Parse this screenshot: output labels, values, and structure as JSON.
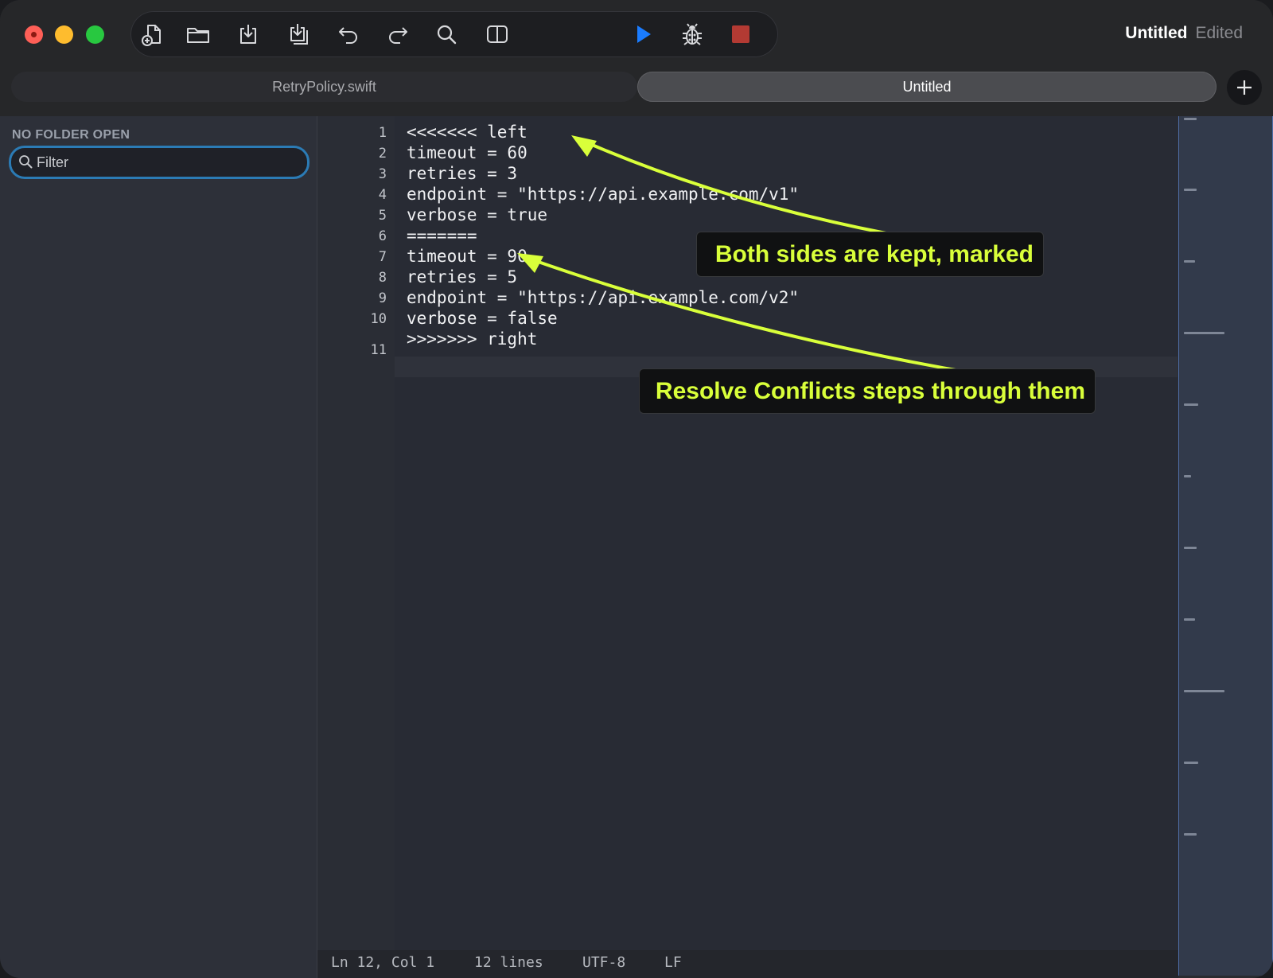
{
  "window": {
    "title": "Untitled",
    "title_status": "Edited"
  },
  "toolbar": {
    "buttons": [
      {
        "name": "new-file",
        "icon": "new-file-icon"
      },
      {
        "name": "open-folder",
        "icon": "folder-icon"
      },
      {
        "name": "save",
        "icon": "download-icon"
      },
      {
        "name": "save-all",
        "icon": "save-all-icon"
      },
      {
        "name": "undo",
        "icon": "undo-icon"
      },
      {
        "name": "redo",
        "icon": "redo-icon"
      },
      {
        "name": "search",
        "icon": "search-icon"
      },
      {
        "name": "split-view",
        "icon": "split-view-icon"
      },
      {
        "name": "run",
        "icon": "play-icon"
      },
      {
        "name": "debug",
        "icon": "bug-icon"
      },
      {
        "name": "stop",
        "icon": "stop-icon"
      }
    ],
    "colors": {
      "run": "#1a7cff",
      "stop": "#b33a33"
    }
  },
  "tabs": [
    {
      "label": "RetryPolicy.swift",
      "active": false
    },
    {
      "label": "Untitled",
      "active": true
    }
  ],
  "sidebar": {
    "title": "NO FOLDER OPEN",
    "filter_placeholder": "Filter"
  },
  "editor": {
    "line_numbers": [
      "1",
      "2",
      "3",
      "4",
      "5",
      "6",
      "7",
      "8",
      "9",
      "10",
      "11"
    ],
    "lines": [
      "<<<<<<< left",
      "timeout = 60",
      "retries = 3",
      "endpoint = \"https://api.example.com/v1\"",
      "verbose = true",
      "=======",
      "timeout = 90",
      "retries = 5",
      "endpoint = \"https://api.example.com/v2\"",
      "verbose = false",
      ">>>>>>> right"
    ]
  },
  "status": {
    "position": "Ln 12, Col 1",
    "line_count": "12 lines",
    "encoding": "UTF-8",
    "line_ending": "LF"
  },
  "annotations": [
    {
      "text": "Both sides are kept, marked",
      "color": "#d9ff3a"
    },
    {
      "text": "Resolve Conflicts steps through them",
      "color": "#d9ff3a"
    }
  ]
}
